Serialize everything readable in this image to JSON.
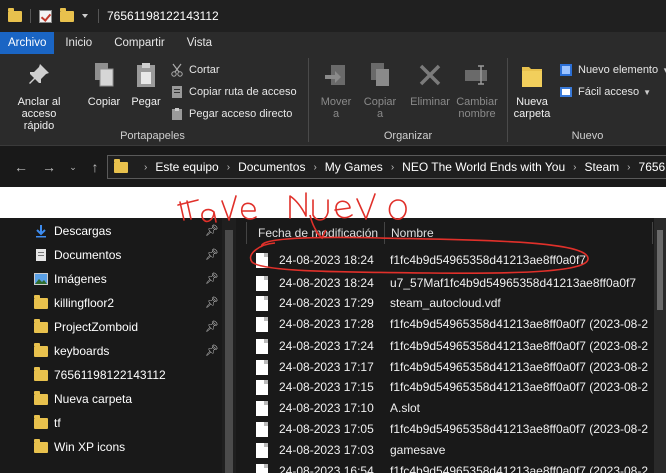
{
  "titlebar": {
    "title": "76561198122143112"
  },
  "tabs": [
    {
      "label": "Archivo"
    },
    {
      "label": "Inicio"
    },
    {
      "label": "Compartir"
    },
    {
      "label": "Vista"
    }
  ],
  "ribbon": {
    "portapapeles": {
      "label": "Portapapeles",
      "pin": "Anclar al acceso rápido",
      "pin_line1": "Anclar al",
      "pin_line2": "acceso rápido",
      "copy": "Copiar",
      "paste": "Pegar",
      "cut": "Cortar",
      "copy_path": "Copiar ruta de acceso",
      "paste_shortcut": "Pegar acceso directo"
    },
    "organizar": {
      "label": "Organizar",
      "move_line1": "Mover",
      "move_line2": "a",
      "copy_line1": "Copiar",
      "copy_line2": "a",
      "delete": "Eliminar",
      "rename_line1": "Cambiar",
      "rename_line2": "nombre"
    },
    "nuevo": {
      "label": "Nuevo",
      "folder_line1": "Nueva",
      "folder_line2": "carpeta",
      "new_item": "Nuevo elemento",
      "easy_access": "Fácil acceso"
    }
  },
  "address": {
    "crumbs": [
      "Este equipo",
      "Documentos",
      "My Games",
      "NEO The World Ends with You",
      "Steam",
      "7656"
    ]
  },
  "sidebar": {
    "items": [
      {
        "label": "Descargas",
        "icon": "download-icon",
        "pinned": true
      },
      {
        "label": "Documentos",
        "icon": "document-icon",
        "pinned": true
      },
      {
        "label": "Imágenes",
        "icon": "pictures-icon",
        "pinned": true
      },
      {
        "label": "killingfloor2",
        "icon": "folder-icon",
        "pinned": true
      },
      {
        "label": "ProjectZomboid",
        "icon": "folder-icon",
        "pinned": true
      },
      {
        "label": "keyboards",
        "icon": "folder-icon",
        "pinned": true
      },
      {
        "label": "76561198122143112",
        "icon": "folder-icon",
        "pinned": false
      },
      {
        "label": "Nueva carpeta",
        "icon": "folder-icon",
        "pinned": false
      },
      {
        "label": "tf",
        "icon": "folder-icon",
        "pinned": false
      },
      {
        "label": "Win XP icons",
        "icon": "folder-icon",
        "pinned": false
      }
    ]
  },
  "filelist": {
    "col_date": "Fecha de modificación",
    "col_name": "Nombre",
    "rows": [
      {
        "date": "24-08-2023 18:24",
        "name": "f1fc4b9d54965358d41213ae8ff0a0f7"
      },
      {
        "date": "24-08-2023 18:24",
        "name": "u7_57Maf1fc4b9d54965358d41213ae8ff0a0f7"
      },
      {
        "date": "24-08-2023 17:29",
        "name": "steam_autocloud.vdf"
      },
      {
        "date": "24-08-2023 17:28",
        "name": "f1fc4b9d54965358d41213ae8ff0a0f7 (2023-08-2"
      },
      {
        "date": "24-08-2023 17:24",
        "name": "f1fc4b9d54965358d41213ae8ff0a0f7 (2023-08-2"
      },
      {
        "date": "24-08-2023 17:17",
        "name": "f1fc4b9d54965358d41213ae8ff0a0f7 (2023-08-2"
      },
      {
        "date": "24-08-2023 17:15",
        "name": "f1fc4b9d54965358d41213ae8ff0a0f7 (2023-08-2"
      },
      {
        "date": "24-08-2023 17:10",
        "name": "A.slot"
      },
      {
        "date": "24-08-2023 17:05",
        "name": "f1fc4b9d54965358d41213ae8ff0a0f7 (2023-08-2"
      },
      {
        "date": "24-08-2023 17:03",
        "name": "gamesave"
      },
      {
        "date": "24-08-2023 16:54",
        "name": "f1fc4b9d54965358d41213ae8ff0a0f7 (2023-08-2"
      }
    ]
  },
  "annotation": {
    "text": "llave nuevo",
    "color": "#e0302a"
  },
  "colors": {
    "accent": "#1a65c4",
    "folder": "#e8c14d",
    "background": "#191919",
    "ribbon": "#2b2b2b"
  }
}
